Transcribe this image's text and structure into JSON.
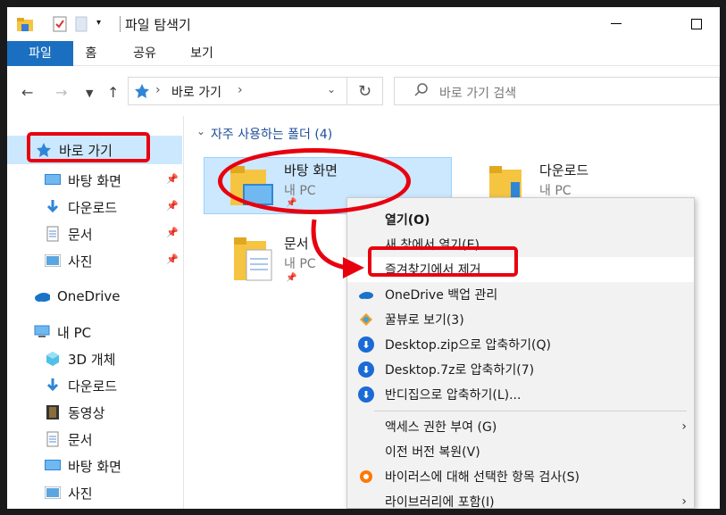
{
  "window": {
    "title": "파일 탐색기",
    "tabs": [
      {
        "label": "파일"
      },
      {
        "label": "홈"
      },
      {
        "label": "공유"
      },
      {
        "label": "보기"
      }
    ]
  },
  "address": {
    "path": "바로 가기",
    "search_placeholder": "바로 가기 검색"
  },
  "nav": {
    "quick_access": "바로 가기",
    "quick_items": [
      {
        "label": "바탕 화면",
        "icon": "desktop-icon"
      },
      {
        "label": "다운로드",
        "icon": "download-icon"
      },
      {
        "label": "문서",
        "icon": "document-icon"
      },
      {
        "label": "사진",
        "icon": "pictures-icon"
      }
    ],
    "onedrive": "OneDrive",
    "this_pc": "내 PC",
    "pc_items": [
      {
        "label": "3D 개체",
        "icon": "3d-objects-icon"
      },
      {
        "label": "다운로드",
        "icon": "download-icon"
      },
      {
        "label": "동영상",
        "icon": "video-icon"
      },
      {
        "label": "문서",
        "icon": "document-icon"
      },
      {
        "label": "바탕 화면",
        "icon": "desktop-icon"
      },
      {
        "label": "사진",
        "icon": "pictures-icon"
      }
    ]
  },
  "main": {
    "section_title": "자주 사용하는 폴더 (4)",
    "tiles": [
      {
        "name": "바탕 화면",
        "sub": "내 PC"
      },
      {
        "name": "다운로드",
        "sub": "내 PC"
      },
      {
        "name": "문서",
        "sub": "내 PC"
      }
    ]
  },
  "context_menu": {
    "items": [
      {
        "label": "열기(O)"
      },
      {
        "label": "새 창에서 열기(E)"
      },
      {
        "label": "즐겨찾기에서 제거"
      },
      {
        "label": "OneDrive 백업 관리"
      },
      {
        "label": "꿀뷰로 보기(3)"
      },
      {
        "label": "Desktop.zip으로 압축하기(Q)"
      },
      {
        "label": "Desktop.7z로 압축하기(7)"
      },
      {
        "label": "반디집으로 압축하기(L)..."
      },
      {
        "label": "액세스 권한 부여 (G)"
      },
      {
        "label": "이전 버전 복원(V)"
      },
      {
        "label": "바이러스에 대해 선택한 항목 검사(S)"
      },
      {
        "label": "라이브러리에 포함(I)"
      }
    ]
  },
  "colors": {
    "accent": "#1a6fc0",
    "selection": "#cce8ff",
    "annotation": "#e8000f",
    "folder": "#f5c542"
  }
}
